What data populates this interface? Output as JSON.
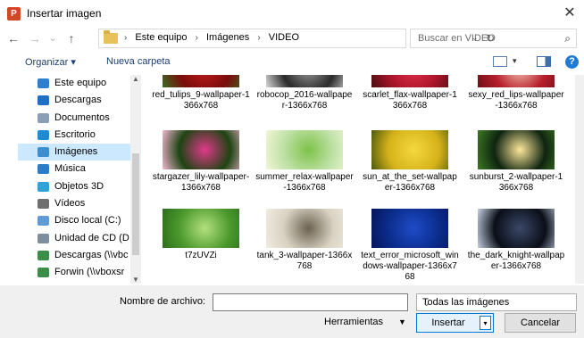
{
  "window": {
    "title": "Insertar imagen",
    "app_icon": "P"
  },
  "nav": {
    "back_icon": "←",
    "forward_icon": "→",
    "up_icon": "↑",
    "dropdown_icon": "⌄"
  },
  "address": {
    "crumbs": [
      "Este equipo",
      "Imágenes",
      "VIDEO"
    ],
    "separator": "›",
    "dropdown_icon": "⌄",
    "refresh_icon": "↻"
  },
  "search": {
    "placeholder": "Buscar en VIDEO",
    "icon": "⌕"
  },
  "toolbar": {
    "organize_label": "Organizar ▾",
    "new_folder_label": "Nueva carpeta",
    "view_dropdown": "▾",
    "help_label": "?"
  },
  "sidebar": {
    "items": [
      {
        "label": "Este equipo",
        "icon": "computer-icon",
        "color": "#2f7fd0"
      },
      {
        "label": "Descargas",
        "icon": "download-icon",
        "color": "#1e6ec8"
      },
      {
        "label": "Documentos",
        "icon": "documents-icon",
        "color": "#8a9fb6"
      },
      {
        "label": "Escritorio",
        "icon": "desktop-icon",
        "color": "#1f8bd4"
      },
      {
        "label": "Imágenes",
        "icon": "pictures-icon",
        "color": "#3d8fd0"
      },
      {
        "label": "Música",
        "icon": "music-icon",
        "color": "#2b7cc9"
      },
      {
        "label": "Objetos 3D",
        "icon": "objects-3d-icon",
        "color": "#2fa3d8"
      },
      {
        "label": "Vídeos",
        "icon": "videos-icon",
        "color": "#6f6f6f"
      },
      {
        "label": "Disco local (C:)",
        "icon": "drive-icon",
        "color": "#5e9ad6"
      },
      {
        "label": "Unidad de CD (D",
        "icon": "cd-drive-icon",
        "color": "#7d8e9c"
      },
      {
        "label": "Descargas (\\\\vbc",
        "icon": "network-drive-icon",
        "color": "#3a8e4a"
      },
      {
        "label": "Forwin (\\\\vboxsr",
        "icon": "network-drive-icon",
        "color": "#3a8e4a"
      }
    ],
    "active_index": 4,
    "scroll_up": "▲",
    "scroll_down": "▼"
  },
  "files": [
    {
      "name": "red_tulips_9-wallpaper-1366x768",
      "colors": [
        "#7a0c0c",
        "#c21d1d",
        "#3a6b1f"
      ]
    },
    {
      "name": "robocop_2016-wallpaper-1366x768",
      "colors": [
        "#2a2a2a",
        "#9a9a9a",
        "#d8d8d8"
      ]
    },
    {
      "name": "scarlet_flax-wallpaper-1366x768",
      "colors": [
        "#a8142a",
        "#e5304a",
        "#4a1010"
      ]
    },
    {
      "name": "sexy_red_lips-wallpaper-1366x768",
      "colors": [
        "#b81e2c",
        "#f2c4b0",
        "#6e0f16"
      ]
    },
    {
      "name": "stargazer_lily-wallpaper-1366x768",
      "colors": [
        "#1e4412",
        "#e0398a",
        "#f4b6d2"
      ]
    },
    {
      "name": "summer_relax-wallpaper-1366x768",
      "colors": [
        "#bfe1a6",
        "#7fc24a",
        "#f2f6d8"
      ]
    },
    {
      "name": "sun_at_the_set-wallpaper-1366x768",
      "colors": [
        "#d6b21a",
        "#f3d93e",
        "#4c5a0e"
      ]
    },
    {
      "name": "sunburst_2-wallpaper-1366x768",
      "colors": [
        "#0e2410",
        "#ffe79a",
        "#3e7a22"
      ]
    },
    {
      "name": "t7zUVZi",
      "colors": [
        "#4c9a2e",
        "#b5e07e",
        "#2b6e1b"
      ]
    },
    {
      "name": "tank_3-wallpaper-1366x768",
      "colors": [
        "#d9d2c2",
        "#6c6252",
        "#f1ece1"
      ]
    },
    {
      "name": "text_error_microsoft_windows-wallpaper-1366x768",
      "colors": [
        "#0b2d8c",
        "#1e4bc8",
        "#06155a"
      ]
    },
    {
      "name": "the_dark_knight-wallpaper-1366x768",
      "colors": [
        "#0a0e18",
        "#3a4868",
        "#c7d2e4"
      ]
    }
  ],
  "bottom": {
    "filename_label": "Nombre de archivo:",
    "filename_value": "",
    "filetype_value": "Todas las imágenes",
    "filetype_arrow": "⌄",
    "tools_label": "Herramientas",
    "tools_arrow": "▼",
    "insert_label": "Insertar",
    "insert_arrow": "▾",
    "cancel_label": "Cancelar"
  },
  "close_icon": "✕"
}
